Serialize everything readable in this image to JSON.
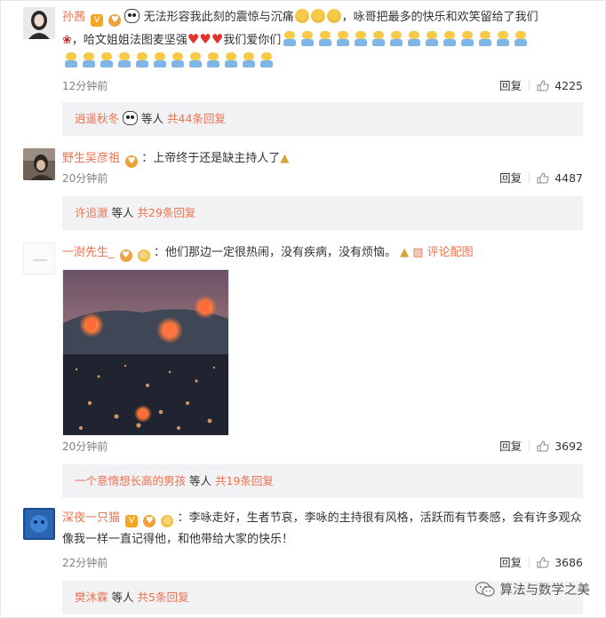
{
  "comments": [
    {
      "user": "孙茜",
      "text_a": "无法形容我此刻的震惊与沉痛",
      "text_b": "，咏哥把最多的快乐和欢笑留给了我们",
      "text_c": "，哈文姐姐法图麦坚强",
      "text_d": "我们爱你们",
      "time": "12分钟前",
      "reply_label": "回复",
      "likes": "4225",
      "replier": "逍遥秋冬",
      "etc": "等人",
      "reply_count": "共44条回复"
    },
    {
      "user": "野生吴彦祖",
      "text": "：上帝终于还是缺主持人了",
      "time": "20分钟前",
      "reply_label": "回复",
      "likes": "4487",
      "replier": "许追澈",
      "etc": "等人",
      "reply_count": "共29条回复"
    },
    {
      "user": "一澍先生_",
      "text": "：他们那边一定很热闹，没有疾病，没有烦恼。",
      "pic_link": "评论配图",
      "time": "20分钟前",
      "reply_label": "回复",
      "likes": "3692",
      "replier": "一个意惰想长高的男孩",
      "etc": "等人",
      "reply_count": "共19条回复"
    },
    {
      "user": "深夜一只猫",
      "text": "：李咏走好，生者节哀，李咏的主持很有风格，活跃而有节奏感，会有许多观众像我一样一直记得他，和他带给大家的快乐！",
      "time": "22分钟前",
      "reply_label": "回复",
      "likes": "3686",
      "replier": "樊沐霖",
      "etc": "等人",
      "reply_count": "共5条回复"
    }
  ],
  "watermark": "算法与数学之美",
  "colors": {
    "link": "#eb7350",
    "reply_bg": "#f2f2f5",
    "meta": "#808080"
  },
  "icons": {
    "like": "thumbs-up-icon",
    "pic": "picture-icon",
    "watermark": "wechat-icon"
  }
}
